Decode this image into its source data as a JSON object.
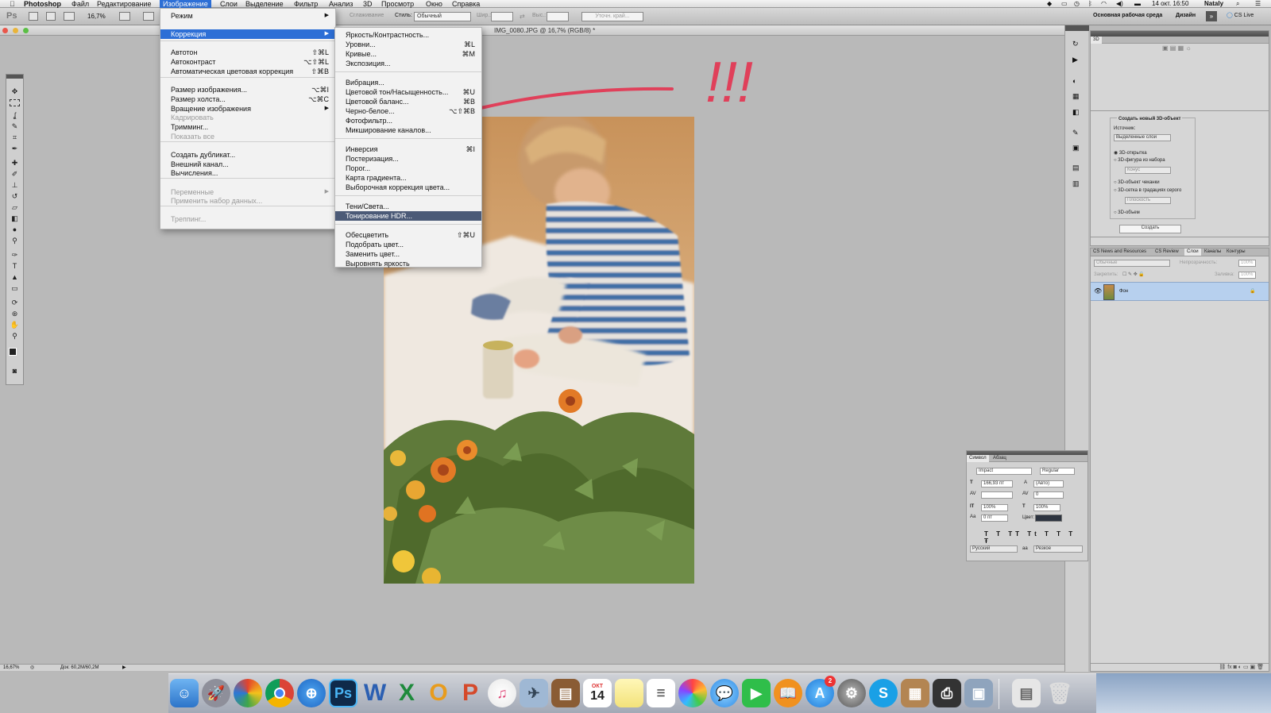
{
  "menubar": {
    "app_name": "Photoshop",
    "items": [
      "Файл",
      "Редактирование",
      "Изображение",
      "Слои",
      "Выделение",
      "Фильтр",
      "Анализ",
      "3D",
      "Просмотр",
      "Окно",
      "Справка"
    ],
    "date_time": "14 окт.  16:50",
    "user": "Nataly"
  },
  "options_bar": {
    "ps_logo": "Ps",
    "zoom": "16,7%",
    "smoothing_label": "Сглаживание",
    "style_label": "Стиль:",
    "style_value": "Обычный",
    "width_label": "Шир.:",
    "height_label": "Выс.:",
    "refine_edge": "Уточн. край...",
    "workspace_main": "Основная рабочая среда",
    "workspace_design": "Дизайн",
    "cs_live": "CS Live"
  },
  "document": {
    "tab_title": "IMG_0080.JPG @ 16,7% (RGB/8) *"
  },
  "image_menu": {
    "items": [
      {
        "label": "Режим",
        "submenu": true
      },
      {
        "label": "Коррекция",
        "submenu": true,
        "highlighted": true
      },
      {
        "label": "Автотон",
        "shortcut": "⇧⌘L"
      },
      {
        "label": "Автоконтраст",
        "shortcut": "⌥⇧⌘L"
      },
      {
        "label": "Автоматическая цветовая коррекция",
        "shortcut": "⇧⌘B"
      },
      {
        "label": "Размер изображения...",
        "shortcut": "⌥⌘I"
      },
      {
        "label": "Размер холста...",
        "shortcut": "⌥⌘C"
      },
      {
        "label": "Вращение изображения",
        "submenu": true
      },
      {
        "label": "Кадрировать",
        "disabled": true
      },
      {
        "label": "Тримминг..."
      },
      {
        "label": "Показать все",
        "disabled": true
      },
      {
        "label": "Создать дубликат..."
      },
      {
        "label": "Внешний канал..."
      },
      {
        "label": "Вычисления..."
      },
      {
        "label": "Переменные",
        "submenu": true,
        "disabled": true
      },
      {
        "label": "Применить набор данных...",
        "disabled": true
      },
      {
        "label": "Треппинг...",
        "disabled": true
      }
    ]
  },
  "correction_menu": {
    "items": [
      {
        "label": "Яркость/Контрастность..."
      },
      {
        "label": "Уровни...",
        "shortcut": "⌘L"
      },
      {
        "label": "Кривые...",
        "shortcut": "⌘M"
      },
      {
        "label": "Экспозиция..."
      },
      {
        "label": "Вибрация..."
      },
      {
        "label": "Цветовой тон/Насыщенность...",
        "shortcut": "⌘U"
      },
      {
        "label": "Цветовой баланс...",
        "shortcut": "⌘B"
      },
      {
        "label": "Черно-белое...",
        "shortcut": "⌥⇧⌘B"
      },
      {
        "label": "Фотофильтр..."
      },
      {
        "label": "Микширование каналов..."
      },
      {
        "label": "Инверсия",
        "shortcut": "⌘I"
      },
      {
        "label": "Постеризация..."
      },
      {
        "label": "Порог..."
      },
      {
        "label": "Карта градиента..."
      },
      {
        "label": "Выборочная коррекция цвета..."
      },
      {
        "label": "Тени/Света..."
      },
      {
        "label": "Тонирование HDR...",
        "hover": true
      },
      {
        "label": "Обесцветить",
        "shortcut": "⇧⌘U"
      },
      {
        "label": "Подобрать цвет..."
      },
      {
        "label": "Заменить цвет..."
      },
      {
        "label": "Выровнять яркость"
      }
    ]
  },
  "annotation": {
    "text": "!!!",
    "color": "#e0405a"
  },
  "panel_3d": {
    "tab": "3D",
    "group_title": "Создать новый 3D-объект",
    "source_label": "Источник:",
    "source_value": "Выделенные слои",
    "options": [
      "3D-открытка",
      "3D-фигура из набора",
      "3D-объект чеканки",
      "3D-сетка в градациях серого",
      "3D-объем"
    ],
    "shape_value": "Конус",
    "plane_value": "Плоскость",
    "create_button": "Создать"
  },
  "layers_panel": {
    "tabs": [
      "CS News and Resources",
      "CS Review",
      "Слои",
      "Каналы",
      "Контуры"
    ],
    "blend_mode": "Обычные",
    "opacity_label": "Непрозрачность:",
    "opacity_value": "100%",
    "lock_label": "Закрепить:",
    "fill_label": "Заливка:",
    "fill_value": "100%",
    "layer_name": "Фон"
  },
  "character_panel": {
    "tabs": [
      "Символ",
      "Абзац"
    ],
    "font_family": "Impact",
    "font_style": "Regular",
    "font_size": "166,93 пт",
    "leading": "(Авто)",
    "tracking": "0",
    "vertical_scale": "100%",
    "horizontal_scale": "100%",
    "baseline": "0 пт",
    "color_label": "Цвет:",
    "language": "Русский",
    "antialias_label": "aa",
    "antialias": "Резкое"
  },
  "status_bar": {
    "zoom": "16,67%",
    "doc_size": "Док: 60,2M/60,2M"
  },
  "dock": {
    "calendar_month": "ОКТ",
    "calendar_day": "14",
    "appstore_badge": "2"
  },
  "colors": {
    "menu_highlight": "#2d6fd6",
    "menu_hover": "#4b5a77",
    "annotation": "#e0405a",
    "layer_selected": "#b7d0ee"
  }
}
